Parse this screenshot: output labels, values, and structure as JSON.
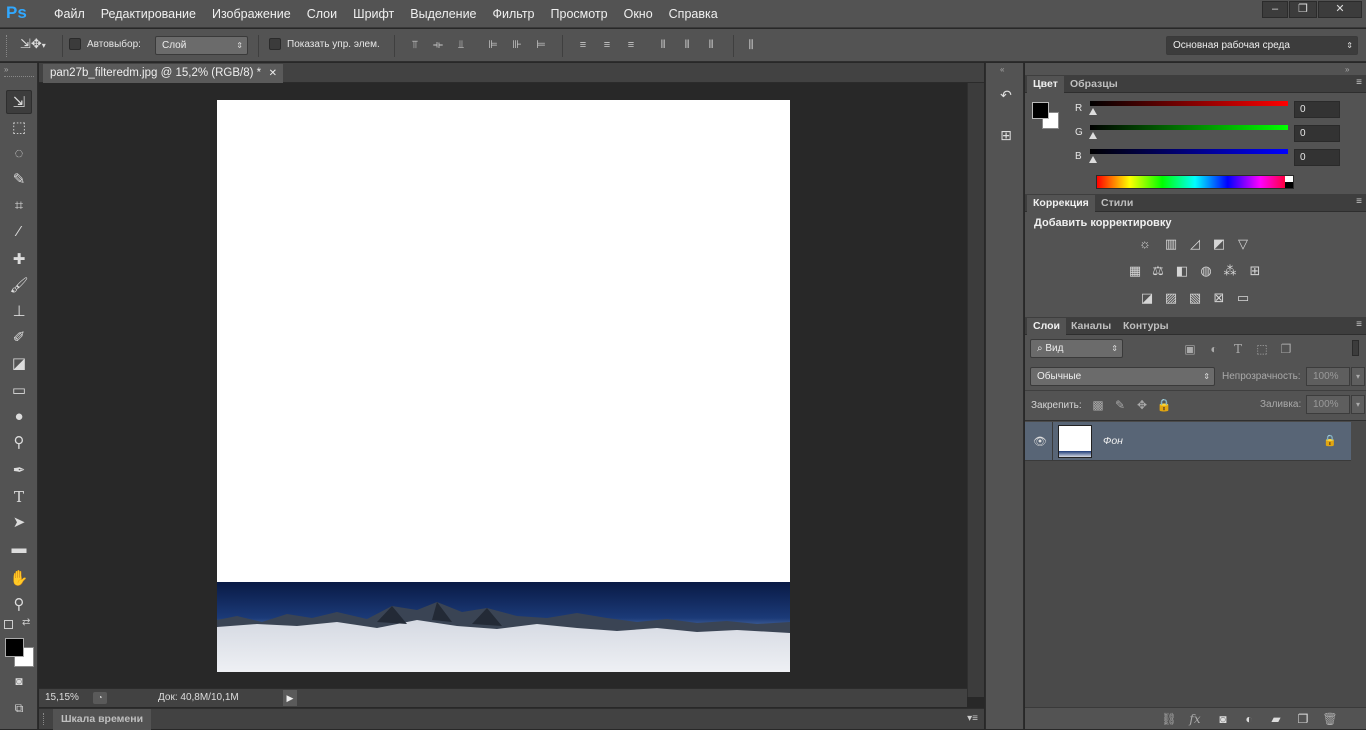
{
  "app": {
    "logo": "Ps"
  },
  "menu": [
    "Файл",
    "Редактирование",
    "Изображение",
    "Слои",
    "Шрифт",
    "Выделение",
    "Фильтр",
    "Просмотр",
    "Окно",
    "Справка"
  ],
  "window_controls": {
    "minimize": "–",
    "restore": "❐",
    "close": "✕"
  },
  "options": {
    "autoselect_label": "Автовыбор:",
    "autoselect_value": "Слой",
    "show_transform_label": "Показать упр. элем.",
    "workspace": "Основная рабочая среда"
  },
  "document": {
    "tab_title": "pan27b_filteredm.jpg @ 15,2% (RGB/8) *",
    "zoom": "15,15%",
    "doc_info": "Док: 40,8M/10,1M"
  },
  "timeline_label": "Шкала времени",
  "color_panel": {
    "tabs": [
      "Цвет",
      "Образцы"
    ],
    "channels": [
      {
        "label": "R",
        "value": "0",
        "color": "#ff0000"
      },
      {
        "label": "G",
        "value": "0",
        "color": "#00ff00"
      },
      {
        "label": "B",
        "value": "0",
        "color": "#0000ff"
      }
    ]
  },
  "adjustments_panel": {
    "tabs": [
      "Коррекция",
      "Стили"
    ],
    "heading": "Добавить корректировку"
  },
  "layers_panel": {
    "tabs": [
      "Слои",
      "Каналы",
      "Контуры"
    ],
    "filter_label": "Вид",
    "blend_mode": "Обычные",
    "opacity_label": "Непрозрачность:",
    "opacity_value": "100%",
    "lock_label": "Закрепить:",
    "fill_label": "Заливка:",
    "fill_value": "100%",
    "layers": [
      {
        "name": "Фон"
      }
    ]
  }
}
